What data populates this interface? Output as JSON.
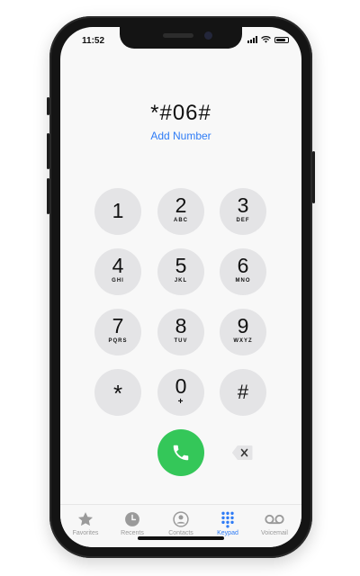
{
  "status": {
    "time": "11:52"
  },
  "dialer": {
    "number": "*#06#",
    "add_number": "Add Number"
  },
  "keypad": [
    {
      "digit": "1",
      "letters": ""
    },
    {
      "digit": "2",
      "letters": "ABC"
    },
    {
      "digit": "3",
      "letters": "DEF"
    },
    {
      "digit": "4",
      "letters": "GHI"
    },
    {
      "digit": "5",
      "letters": "JKL"
    },
    {
      "digit": "6",
      "letters": "MNO"
    },
    {
      "digit": "7",
      "letters": "PQRS"
    },
    {
      "digit": "8",
      "letters": "TUV"
    },
    {
      "digit": "9",
      "letters": "WXYZ"
    },
    {
      "digit": "*",
      "letters": ""
    },
    {
      "digit": "0",
      "letters": "+"
    },
    {
      "digit": "#",
      "letters": ""
    }
  ],
  "call_icon": "phone-icon",
  "backspace_icon": "delete-icon",
  "tabs": [
    {
      "label": "Favorites",
      "icon": "star-icon",
      "active": false
    },
    {
      "label": "Recents",
      "icon": "clock-icon",
      "active": false
    },
    {
      "label": "Contacts",
      "icon": "person-icon",
      "active": false
    },
    {
      "label": "Keypad",
      "icon": "keypad-icon",
      "active": true
    },
    {
      "label": "Voicemail",
      "icon": "voicemail-icon",
      "active": false
    }
  ],
  "colors": {
    "accent": "#2f7cf6",
    "call_green": "#34c759",
    "key_gray": "#e4e4e6",
    "inactive_tab": "#9a9a9a"
  }
}
